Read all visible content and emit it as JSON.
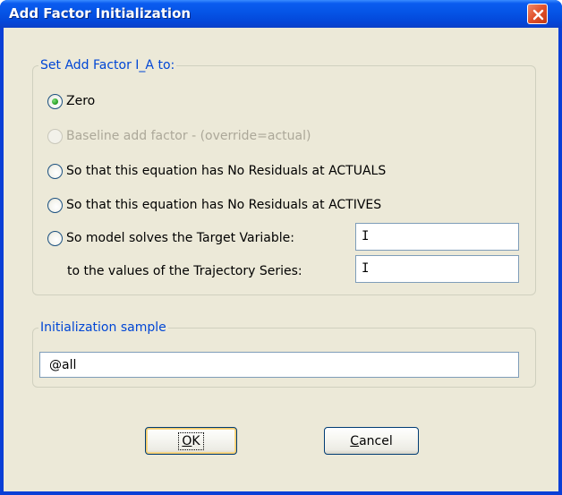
{
  "window": {
    "title": "Add Factor Initialization"
  },
  "set_group": {
    "legend": "Set Add Factor I_A to:",
    "options": [
      {
        "label": "Zero",
        "checked": true,
        "enabled": true
      },
      {
        "label": "Baseline add factor - (override=actual)",
        "checked": false,
        "enabled": false
      },
      {
        "label": "So that this equation has No Residuals at ACTUALS",
        "checked": false,
        "enabled": true
      },
      {
        "label": "So that this equation has No Residuals at ACTIVES",
        "checked": false,
        "enabled": true
      },
      {
        "label": "So model solves the Target Variable:",
        "checked": false,
        "enabled": true
      }
    ],
    "target_variable_value": "I",
    "trajectory_label": "to the values of the Trajectory Series:",
    "trajectory_series_value": "I"
  },
  "sample_group": {
    "legend": "Initialization sample",
    "value": "@all"
  },
  "buttons": {
    "ok_mnemonic": "O",
    "ok_rest": "K",
    "cancel_mnemonic": "C",
    "cancel_rest": "ancel"
  },
  "colors": {
    "title_bar": "#0554e6",
    "dialog_bg": "#ece9d8",
    "group_legend": "#0046d5",
    "close_button": "#e0502a"
  },
  "icons": {
    "close": "close-icon"
  }
}
